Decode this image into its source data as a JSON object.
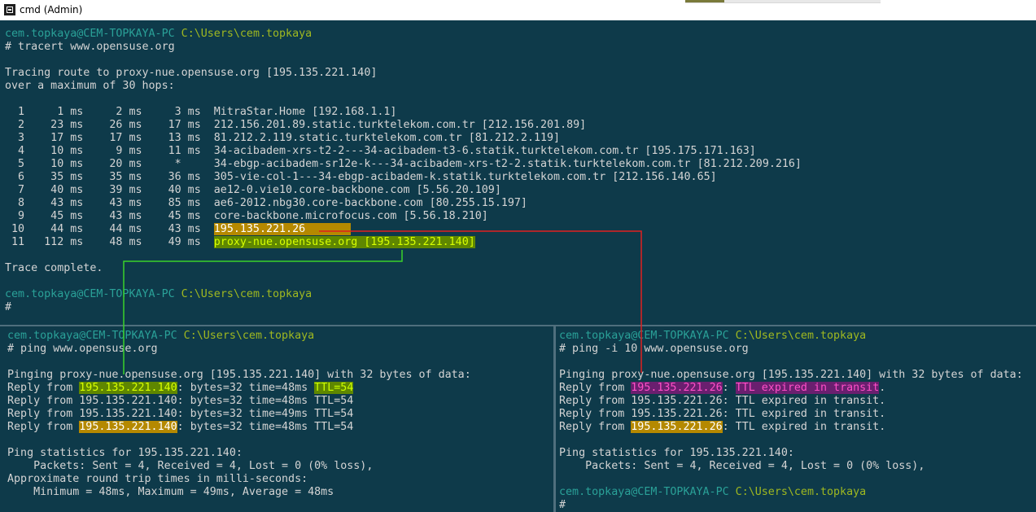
{
  "window": {
    "title": "cmd (Admin)"
  },
  "top": {
    "prompt_user": "cem.topkaya@CEM-TOPKAYA-PC",
    "prompt_path": "C:\\Users\\cem.topkaya",
    "command": "# tracert www.opensuse.org",
    "trace_line1": "Tracing route to proxy-nue.opensuse.org [195.135.221.140]",
    "trace_line2": "over a maximum of 30 hops:",
    "hops": [
      {
        "prefix": "  1     1 ms     2 ms     3 ms  ",
        "host": "MitraStar.Home [192.168.1.1]"
      },
      {
        "prefix": "  2    23 ms    26 ms    17 ms  ",
        "host": "212.156.201.89.static.turktelekom.com.tr [212.156.201.89]"
      },
      {
        "prefix": "  3    17 ms    17 ms    13 ms  ",
        "host": "81.212.2.119.static.turktelekom.com.tr [81.212.2.119]"
      },
      {
        "prefix": "  4    10 ms     9 ms    11 ms  ",
        "host": "34-acibadem-xrs-t2-2---34-acibadem-t3-6.statik.turktelekom.com.tr [195.175.171.163]"
      },
      {
        "prefix": "  5    10 ms    20 ms     *     ",
        "host": "34-ebgp-acibadem-sr12e-k---34-acibadem-xrs-t2-2.statik.turktelekom.com.tr [81.212.209.216]"
      },
      {
        "prefix": "  6    35 ms    35 ms    36 ms  ",
        "host": "305-vie-col-1---34-ebgp-acibadem-k.statik.turktelekom.com.tr [212.156.140.65]"
      },
      {
        "prefix": "  7    40 ms    39 ms    40 ms  ",
        "host": "ae12-0.vie10.core-backbone.com [5.56.20.109]"
      },
      {
        "prefix": "  8    43 ms    43 ms    85 ms  ",
        "host": "ae6-2012.nbg30.core-backbone.com [80.255.15.197]"
      },
      {
        "prefix": "  9    45 ms    43 ms    45 ms  ",
        "host": "core-backbone.microfocus.com [5.56.18.210]"
      },
      {
        "prefix": " 10    44 ms    44 ms    43 ms  ",
        "host": "195.135.221.26       "
      },
      {
        "prefix": " 11   112 ms    48 ms    49 ms  ",
        "host": "proxy-nue.opensuse.org [195.135.221.140]"
      }
    ],
    "complete": "Trace complete.",
    "prompt2_user": "cem.topkaya@CEM-TOPKAYA-PC",
    "prompt2_path": "C:\\Users\\cem.topkaya",
    "cursor_line": "#"
  },
  "left": {
    "prompt_user": "cem.topkaya@CEM-TOPKAYA-PC",
    "prompt_path": "C:\\Users\\cem.topkaya",
    "command": "# ping www.opensuse.org",
    "pinging": "Pinging proxy-nue.opensuse.org [195.135.221.140] with 32 bytes of data:",
    "reply_prefix": "Reply from ",
    "ip": "195.135.221.140",
    "r1_mid": ": bytes=32 time=48ms ",
    "r1_ttl": "TTL=54",
    "r2": "Reply from 195.135.221.140: bytes=32 time=48ms TTL=54",
    "r3": "Reply from 195.135.221.140: bytes=32 time=49ms TTL=54",
    "r4_rest": ": bytes=32 time=48ms TTL=54",
    "stats_title": "Ping statistics for 195.135.221.140:",
    "stats_packets": "    Packets: Sent = 4, Received = 4, Lost = 0 (0% loss),",
    "approx": "Approximate round trip times in milli-seconds:",
    "minmax": "    Minimum = 48ms, Maximum = 49ms, Average = 48ms"
  },
  "right": {
    "prompt_user": "cem.topkaya@CEM-TOPKAYA-PC",
    "prompt_path": "C:\\Users\\cem.topkaya",
    "command": "# ping -i 10 www.opensuse.org",
    "pinging": "Pinging proxy-nue.opensuse.org [195.135.221.140] with 32 bytes of data:",
    "reply_prefix": "Reply from ",
    "ip": "195.135.221.26",
    "colon": ": ",
    "ttl_expired": "TTL expired in transit",
    "dot": ".",
    "r2": "Reply from 195.135.221.26: TTL expired in transit.",
    "r3": "Reply from 195.135.221.26: TTL expired in transit.",
    "r4_rest": ": TTL expired in transit.",
    "stats_title": "Ping statistics for 195.135.221.140:",
    "stats_packets": "    Packets: Sent = 4, Received = 4, Lost = 0 (0% loss),",
    "prompt2_user": "cem.topkaya@CEM-TOPKAYA-PC",
    "prompt2_path": "C:\\Users\\cem.topkaya",
    "cursor_line": "#"
  },
  "colors": {
    "terminal_bg": "#0e3a4a",
    "prompt_user": "#2aa198",
    "prompt_path": "#9fb820",
    "highlight_orange": "#b58900",
    "highlight_green": "#5f8700",
    "highlight_magenta": "#6a1f6f",
    "connector_red": "#e01f1f",
    "connector_green": "#3ad12a"
  }
}
